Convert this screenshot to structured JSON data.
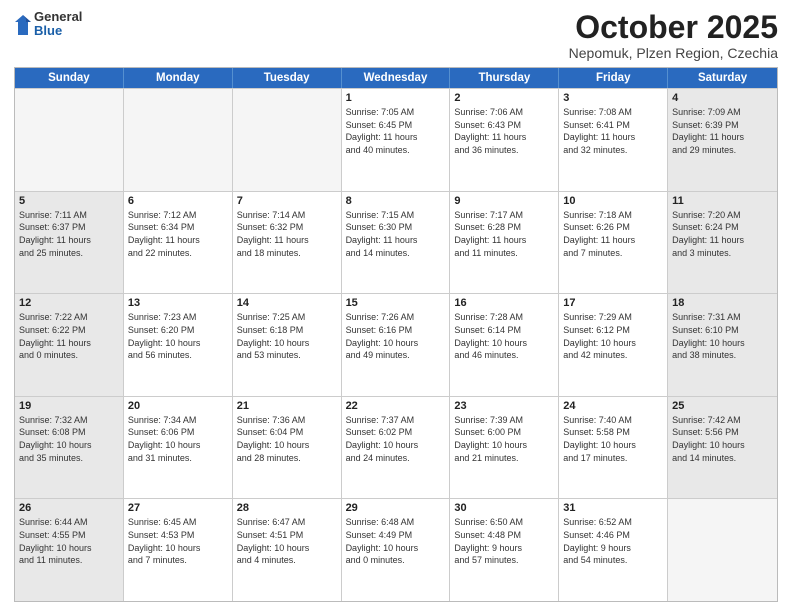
{
  "header": {
    "logo_general": "General",
    "logo_blue": "Blue",
    "month_title": "October 2025",
    "location": "Nepomuk, Plzen Region, Czechia"
  },
  "weekdays": [
    "Sunday",
    "Monday",
    "Tuesday",
    "Wednesday",
    "Thursday",
    "Friday",
    "Saturday"
  ],
  "rows": [
    [
      {
        "day": "",
        "text": "",
        "empty": true
      },
      {
        "day": "",
        "text": "",
        "empty": true
      },
      {
        "day": "",
        "text": "",
        "empty": true
      },
      {
        "day": "1",
        "text": "Sunrise: 7:05 AM\nSunset: 6:45 PM\nDaylight: 11 hours\nand 40 minutes."
      },
      {
        "day": "2",
        "text": "Sunrise: 7:06 AM\nSunset: 6:43 PM\nDaylight: 11 hours\nand 36 minutes."
      },
      {
        "day": "3",
        "text": "Sunrise: 7:08 AM\nSunset: 6:41 PM\nDaylight: 11 hours\nand 32 minutes."
      },
      {
        "day": "4",
        "text": "Sunrise: 7:09 AM\nSunset: 6:39 PM\nDaylight: 11 hours\nand 29 minutes.",
        "shaded": true
      }
    ],
    [
      {
        "day": "5",
        "text": "Sunrise: 7:11 AM\nSunset: 6:37 PM\nDaylight: 11 hours\nand 25 minutes.",
        "shaded": true
      },
      {
        "day": "6",
        "text": "Sunrise: 7:12 AM\nSunset: 6:34 PM\nDaylight: 11 hours\nand 22 minutes."
      },
      {
        "day": "7",
        "text": "Sunrise: 7:14 AM\nSunset: 6:32 PM\nDaylight: 11 hours\nand 18 minutes."
      },
      {
        "day": "8",
        "text": "Sunrise: 7:15 AM\nSunset: 6:30 PM\nDaylight: 11 hours\nand 14 minutes."
      },
      {
        "day": "9",
        "text": "Sunrise: 7:17 AM\nSunset: 6:28 PM\nDaylight: 11 hours\nand 11 minutes."
      },
      {
        "day": "10",
        "text": "Sunrise: 7:18 AM\nSunset: 6:26 PM\nDaylight: 11 hours\nand 7 minutes."
      },
      {
        "day": "11",
        "text": "Sunrise: 7:20 AM\nSunset: 6:24 PM\nDaylight: 11 hours\nand 3 minutes.",
        "shaded": true
      }
    ],
    [
      {
        "day": "12",
        "text": "Sunrise: 7:22 AM\nSunset: 6:22 PM\nDaylight: 11 hours\nand 0 minutes.",
        "shaded": true
      },
      {
        "day": "13",
        "text": "Sunrise: 7:23 AM\nSunset: 6:20 PM\nDaylight: 10 hours\nand 56 minutes."
      },
      {
        "day": "14",
        "text": "Sunrise: 7:25 AM\nSunset: 6:18 PM\nDaylight: 10 hours\nand 53 minutes."
      },
      {
        "day": "15",
        "text": "Sunrise: 7:26 AM\nSunset: 6:16 PM\nDaylight: 10 hours\nand 49 minutes."
      },
      {
        "day": "16",
        "text": "Sunrise: 7:28 AM\nSunset: 6:14 PM\nDaylight: 10 hours\nand 46 minutes."
      },
      {
        "day": "17",
        "text": "Sunrise: 7:29 AM\nSunset: 6:12 PM\nDaylight: 10 hours\nand 42 minutes."
      },
      {
        "day": "18",
        "text": "Sunrise: 7:31 AM\nSunset: 6:10 PM\nDaylight: 10 hours\nand 38 minutes.",
        "shaded": true
      }
    ],
    [
      {
        "day": "19",
        "text": "Sunrise: 7:32 AM\nSunset: 6:08 PM\nDaylight: 10 hours\nand 35 minutes.",
        "shaded": true
      },
      {
        "day": "20",
        "text": "Sunrise: 7:34 AM\nSunset: 6:06 PM\nDaylight: 10 hours\nand 31 minutes."
      },
      {
        "day": "21",
        "text": "Sunrise: 7:36 AM\nSunset: 6:04 PM\nDaylight: 10 hours\nand 28 minutes."
      },
      {
        "day": "22",
        "text": "Sunrise: 7:37 AM\nSunset: 6:02 PM\nDaylight: 10 hours\nand 24 minutes."
      },
      {
        "day": "23",
        "text": "Sunrise: 7:39 AM\nSunset: 6:00 PM\nDaylight: 10 hours\nand 21 minutes."
      },
      {
        "day": "24",
        "text": "Sunrise: 7:40 AM\nSunset: 5:58 PM\nDaylight: 10 hours\nand 17 minutes."
      },
      {
        "day": "25",
        "text": "Sunrise: 7:42 AM\nSunset: 5:56 PM\nDaylight: 10 hours\nand 14 minutes.",
        "shaded": true
      }
    ],
    [
      {
        "day": "26",
        "text": "Sunrise: 6:44 AM\nSunset: 4:55 PM\nDaylight: 10 hours\nand 11 minutes.",
        "shaded": true
      },
      {
        "day": "27",
        "text": "Sunrise: 6:45 AM\nSunset: 4:53 PM\nDaylight: 10 hours\nand 7 minutes."
      },
      {
        "day": "28",
        "text": "Sunrise: 6:47 AM\nSunset: 4:51 PM\nDaylight: 10 hours\nand 4 minutes."
      },
      {
        "day": "29",
        "text": "Sunrise: 6:48 AM\nSunset: 4:49 PM\nDaylight: 10 hours\nand 0 minutes."
      },
      {
        "day": "30",
        "text": "Sunrise: 6:50 AM\nSunset: 4:48 PM\nDaylight: 9 hours\nand 57 minutes."
      },
      {
        "day": "31",
        "text": "Sunrise: 6:52 AM\nSunset: 4:46 PM\nDaylight: 9 hours\nand 54 minutes."
      },
      {
        "day": "",
        "text": "",
        "empty": true
      }
    ]
  ]
}
